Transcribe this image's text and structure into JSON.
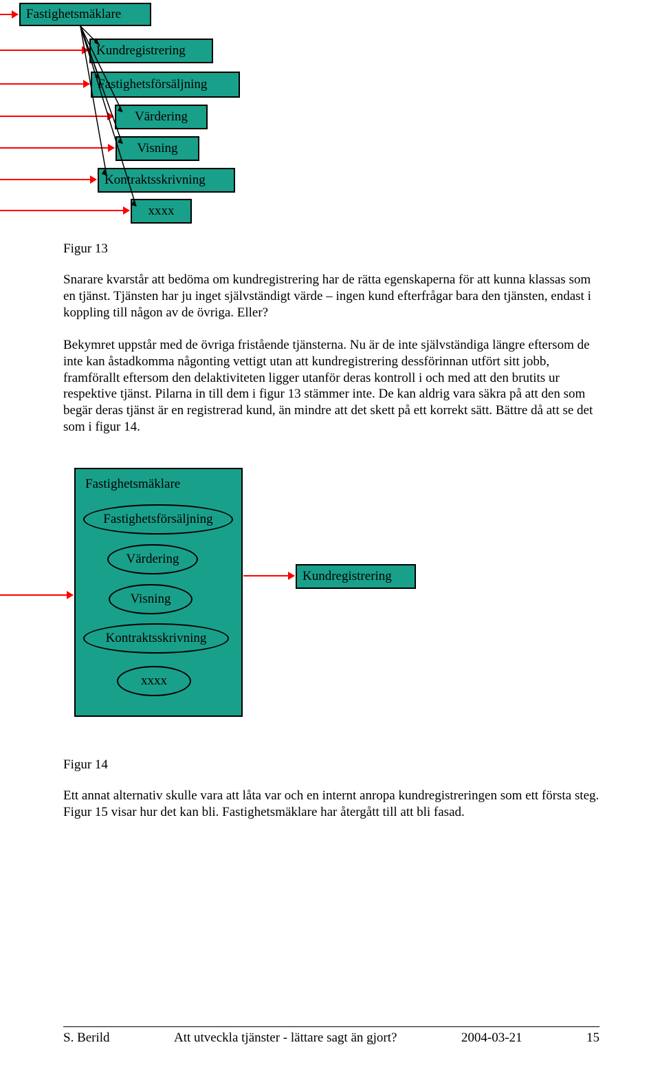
{
  "diagram1": {
    "root": "Fastighetsmäklare",
    "children": [
      "Kundregistrering",
      "Fastighetsförsäljning",
      "Värdering",
      "Visning",
      "Kontraktsskrivning",
      "xxxx"
    ]
  },
  "figure13_caption": "Figur 13",
  "paragraph1": "Snarare kvarstår att bedöma om kundregistrering har de rätta egenskaperna för att kunna klassas som en tjänst. Tjänsten har ju inget självständigt värde – ingen kund efterfrågar bara den tjänsten, endast i koppling till någon av de övriga. Eller?",
  "paragraph2": "Bekymret uppstår med de övriga fristående tjänsterna. Nu är de inte självständiga längre eftersom de inte kan åstadkomma någonting vettigt utan att kundregistrering dessförinnan utfört sitt jobb, framförallt eftersom den delaktiviteten ligger utanför deras kontroll i och med att den brutits ur respektive tjänst. Pilarna in till dem i figur 13 stämmer inte. De kan aldrig vara säkra på att den som begär deras tjänst är en registrerad kund, än mindre att det skett på ett korrekt sätt. Bättre då att se det som i figur 14.",
  "diagram2": {
    "container": "Fastighetsmäklare",
    "ellipses": [
      "Fastighetsförsäljning",
      "Värdering",
      "Visning",
      "Kontraktsskrivning",
      "xxxx"
    ],
    "side_box": "Kundregistrering"
  },
  "figure14_caption": "Figur 14",
  "paragraph3": "Ett annat alternativ skulle vara att låta var och en internt anropa kundregistreringen som ett första steg. Figur 15 visar hur det kan bli. Fastighetsmäklare har återgått till att bli fasad.",
  "footer": {
    "author": "S. Berild",
    "title": "Att utveckla tjänster - lättare sagt än gjort?",
    "date": "2004-03-21",
    "page": "15"
  }
}
